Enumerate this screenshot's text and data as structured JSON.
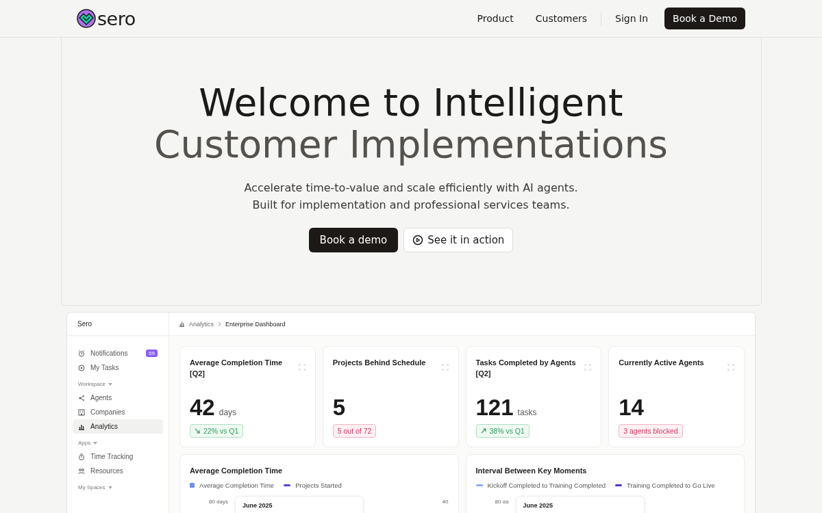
{
  "nav": {
    "logo": "sero",
    "links": [
      "Product",
      "Customers"
    ],
    "sign_in": "Sign In",
    "cta": "Book a Demo"
  },
  "hero": {
    "title_lines": [
      "Welcome to Intelligent",
      "Customer Implementations"
    ],
    "subtitle_lines": [
      "Accelerate time-to-value and scale efficiently with AI agents.",
      "Built for implementation and professional services teams."
    ],
    "primary_button": "Book a demo",
    "secondary_button": "See it in action"
  },
  "app": {
    "name": "Sero",
    "top_items": [
      {
        "label": "Notifications",
        "badge": "59",
        "selected": false
      },
      {
        "label": "My Tasks",
        "selected": false
      }
    ],
    "groups": [
      {
        "label": "Workspace",
        "items": [
          {
            "label": "Agents",
            "selected": false
          },
          {
            "label": "Companies",
            "selected": false
          },
          {
            "label": "Analytics",
            "selected": true
          }
        ]
      },
      {
        "label": "Apps",
        "items": [
          {
            "label": "Time Tracking",
            "selected": false
          },
          {
            "label": "Resources",
            "selected": false
          }
        ]
      },
      {
        "label": "My Spaces"
      }
    ],
    "breadcrumb": [
      "Analytics",
      "Enterprise Dashboard"
    ],
    "stat_cards": [
      {
        "title": "Average Completion Time [Q2]",
        "value": "42",
        "unit": "days",
        "badge": {
          "text": "22% vs Q1",
          "kind": "positive",
          "rising": false
        }
      },
      {
        "title": "Projects Behind Schedule",
        "value": "5",
        "badge": {
          "text": "5 out of 72",
          "kind": "negative"
        }
      },
      {
        "title": "Tasks Completed by Agents [Q2]",
        "value": "121",
        "unit": "tasks",
        "badge": {
          "text": "38% vs Q1",
          "kind": "positive",
          "rising": true
        }
      },
      {
        "title": "Currently Active Agents",
        "value": "14",
        "badge": {
          "text": "3 agents blocked",
          "kind": "negative"
        }
      }
    ],
    "chart_cards": [
      {
        "title": "Average Completion Time",
        "legend": [
          {
            "label": "Average Completion Time",
            "kind": "square",
            "color": "#6b8ff0"
          },
          {
            "label": "Projects Started",
            "kind": "line",
            "color": "#5b3fd6"
          }
        ],
        "left_axis_label": "80 days",
        "right_axis_label": "40",
        "tooltip_title": "June 2025"
      },
      {
        "title": "Interval Between Key Moments",
        "legend": [
          {
            "label": "Kickoff Completed to Training Completed",
            "kind": "line",
            "color": "#8aaaf2"
          },
          {
            "label": "Training Completed to Go Live",
            "kind": "line",
            "color": "#4f35c9"
          }
        ],
        "left_axis_label": "80 da",
        "tooltip_title": "June 2025"
      }
    ]
  }
}
